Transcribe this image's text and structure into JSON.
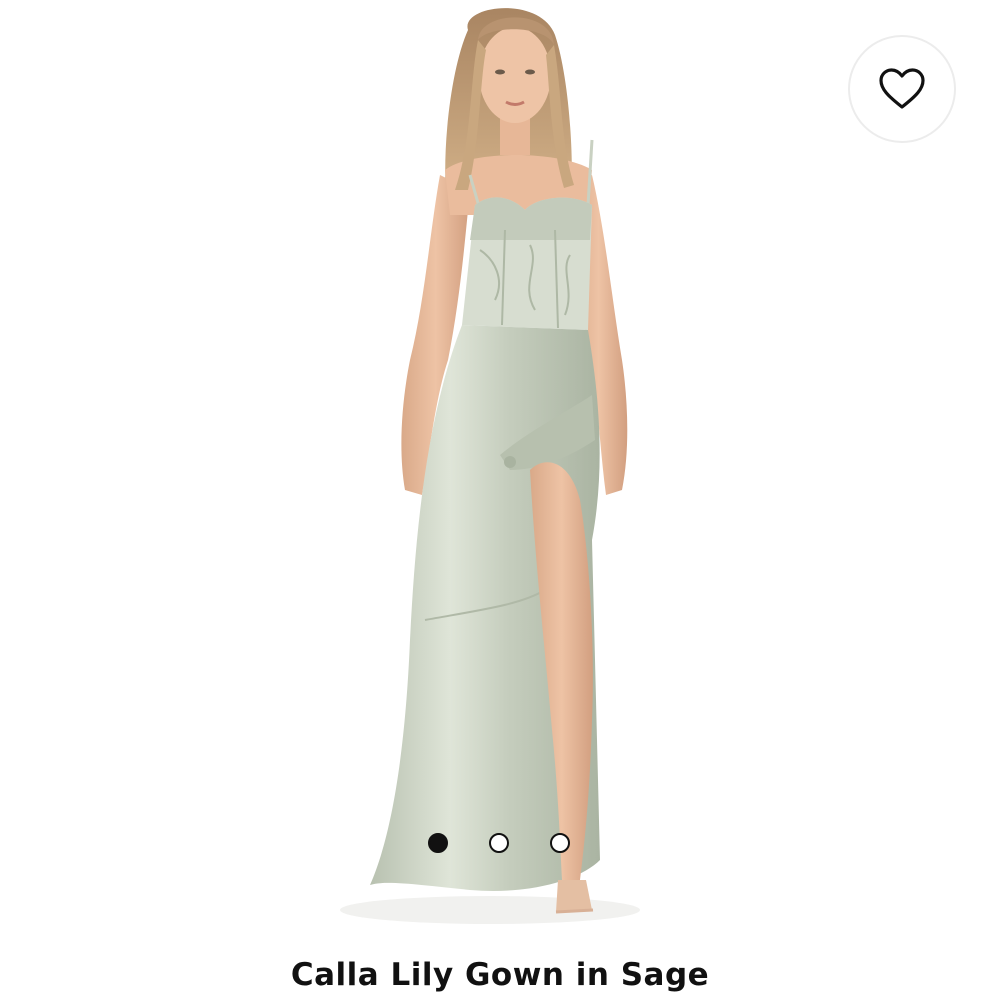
{
  "product": {
    "title": "Calla Lily Gown in Sage",
    "image_alt": "Model wearing a sage satin gown with lace corset bodice and thigh-high slit"
  },
  "favorite": {
    "icon": "heart-outline-icon"
  },
  "carousel": {
    "total_slides": 3,
    "active_index": 0
  },
  "colors": {
    "dress": "#c9d1c2",
    "background": "#ffffff",
    "text": "#111111"
  }
}
